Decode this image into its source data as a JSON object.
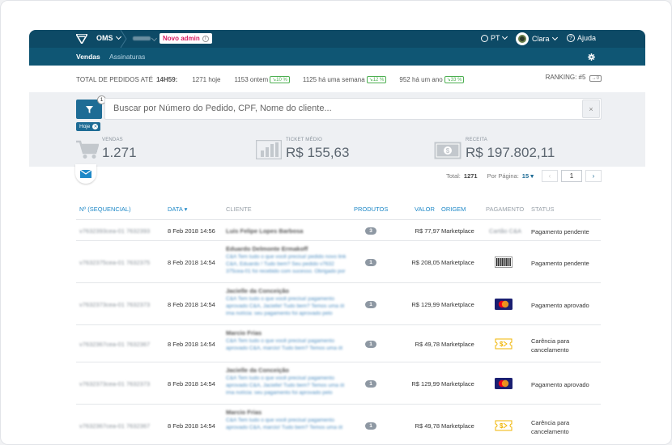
{
  "nav": {
    "module": "OMS",
    "badge": "Novo admin",
    "language": "PT",
    "user": "Clara",
    "help": "Ajuda",
    "tabs": [
      "Vendas",
      "Assinaturas"
    ]
  },
  "summary": {
    "label": "TOTAL DE PEDIDOS ATÉ",
    "time": "14H59:",
    "today": "1271 hoje",
    "yesterday": "1153 ontem",
    "yesterday_pct": "10 %",
    "week": "1125 há uma semana",
    "week_pct": "12 %",
    "year": "952 há um ano",
    "year_pct": "33 %",
    "ranking": "RANKING: #5",
    "ranking_delta": "0"
  },
  "search": {
    "placeholder": "Buscar por Número do Pedido, CPF, Nome do cliente...",
    "filter_count": "1",
    "clear": "×",
    "chip": "Hoje"
  },
  "kpis": {
    "vendas_label": "VENDAS",
    "vendas_value": "1.271",
    "ticket_label": "TICKET MÉDIO",
    "ticket_value": "R$ 155,63",
    "receita_label": "RECEITA",
    "receita_value": "R$ 197.802,11"
  },
  "pager": {
    "total_label": "Total:",
    "total": "1271",
    "per_page_label": "Por Página:",
    "per_page": "15",
    "page": "1"
  },
  "colors": {
    "nav_dark": "#0d4a66",
    "nav_sub": "#0f5674",
    "accent": "#1e6c95",
    "link": "#1e88c7",
    "positive": "#4caf50"
  },
  "table": {
    "headers": {
      "id": "Nº (SEQUENCIAL)",
      "date": "DATA",
      "client": "CLIENTE",
      "products": "PRODUTOS",
      "value": "VALOR",
      "origin": "ORIGEM",
      "payment": "PAGAMENTO",
      "status": "STATUS"
    },
    "rows": [
      {
        "id": "v7632393cea-01 7632393",
        "date": "8 Feb 2018 14:56",
        "name": "Luis Felipe Lopes Barbosa",
        "msg": "",
        "products": "3",
        "value": "R$ 77,97",
        "origin": "Marketplace",
        "payment": "Cartão C&A",
        "payment_icon": "card-text-icon",
        "status": "Pagamento pendente"
      },
      {
        "id": "v7632375cea-01 7632375",
        "date": "8 Feb 2018 14:54",
        "name": "Eduardo Delmonte Ermakoff",
        "msg": "C&A Tem tudo o que você precisa! pedido novo link C&A, Eduardo ! Tudo bem? Seu pedido v7632 375cea-01 foi recebido com sucesso. Obrigado por",
        "products": "1",
        "value": "R$ 208,05",
        "origin": "Marketplace",
        "payment": "",
        "payment_icon": "barcode-icon",
        "status": "Pagamento pendente"
      },
      {
        "id": "v7632373cea-01 7632373",
        "date": "8 Feb 2018 14:54",
        "name": "Jacielle da Conceição",
        "msg": "C&A Tem tudo o que você precisa! pagamento aprovado C&A, Jacielle! Tudo bem? Temos uma ót ima notícia: seu pagamento foi aprovado pelo",
        "products": "1",
        "value": "R$ 129,99",
        "origin": "Marketplace",
        "payment": "",
        "payment_icon": "mastercard-icon",
        "status": "Pagamento aprovado"
      },
      {
        "id": "v7632367cea-01 7632367",
        "date": "8 Feb 2018 14:54",
        "name": "Marcio Frias",
        "msg": "C&A Tem tudo o que você precisa! pagamento aprovado C&A, marcio! Tudo bem? Temos uma ót",
        "products": "1",
        "value": "R$ 49,78",
        "origin": "Marketplace",
        "payment": "",
        "payment_icon": "voucher-icon",
        "status": "Carência para cancelamento"
      },
      {
        "id": "v7632373cea-01 7632373",
        "date": "8 Feb 2018 14:54",
        "name": "Jacielle da Conceição",
        "msg": "C&A Tem tudo o que você precisa! pagamento aprovado C&A, Jacielle! Tudo bem? Temos uma ót ima notícia: seu pagamento foi aprovado pelo",
        "products": "1",
        "value": "R$ 129,99",
        "origin": "Marketplace",
        "payment": "",
        "payment_icon": "mastercard-icon",
        "status": "Pagamento aprovado"
      },
      {
        "id": "v7632367cea-01 7632367",
        "date": "8 Feb 2018 14:54",
        "name": "Marcio Frias",
        "msg": "C&A Tem tudo o que você precisa! pagamento aprovado C&A, marcio! Tudo bem? Temos uma ót",
        "products": "1",
        "value": "R$ 49,78",
        "origin": "Marketplace",
        "payment": "",
        "payment_icon": "voucher-icon",
        "status": "Carência para cancelamento"
      }
    ]
  }
}
